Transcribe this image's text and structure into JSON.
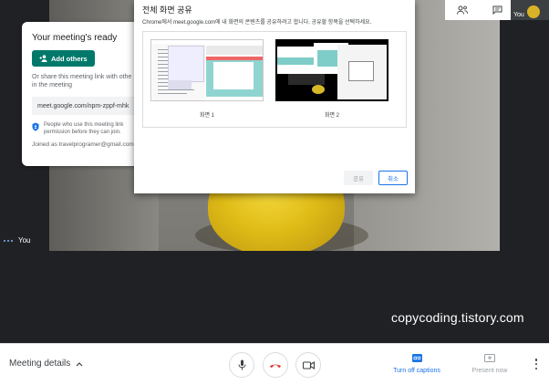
{
  "video": {
    "self_label": "You"
  },
  "watermark": "copycoding.tistory.com",
  "top_right": {
    "self_tile_label": "You"
  },
  "ready_panel": {
    "title": "Your meeting's ready",
    "add_others": "Add others",
    "share_text_1": "Or share this meeting link with othe",
    "share_text_2": "in the meeting",
    "link": "meet.google.com/npm-zppf-mhk",
    "permission_1": "People who use this meeting link",
    "permission_2": "permission before they can join.",
    "joined_as": "Joined as travelprogramer@gmail.com"
  },
  "share_dialog": {
    "title": "전체 화면 공유",
    "subtitle": "Chrome에서 meet.google.com에 내 화면의 콘텐츠를 공유하려고 합니다. 공유할 항목을 선택하세요.",
    "screens": [
      {
        "label": "화면 1"
      },
      {
        "label": "화면 2"
      }
    ],
    "share_button": "공유",
    "cancel_button": "취소"
  },
  "toolbar": {
    "meeting_details": "Meeting details",
    "captions_label": "Turn off captions",
    "present_label": "Present now"
  },
  "colors": {
    "accent_teal": "#00796b",
    "accent_blue": "#1a73e8",
    "hangup_red": "#d93025",
    "background_dark": "#202124"
  }
}
